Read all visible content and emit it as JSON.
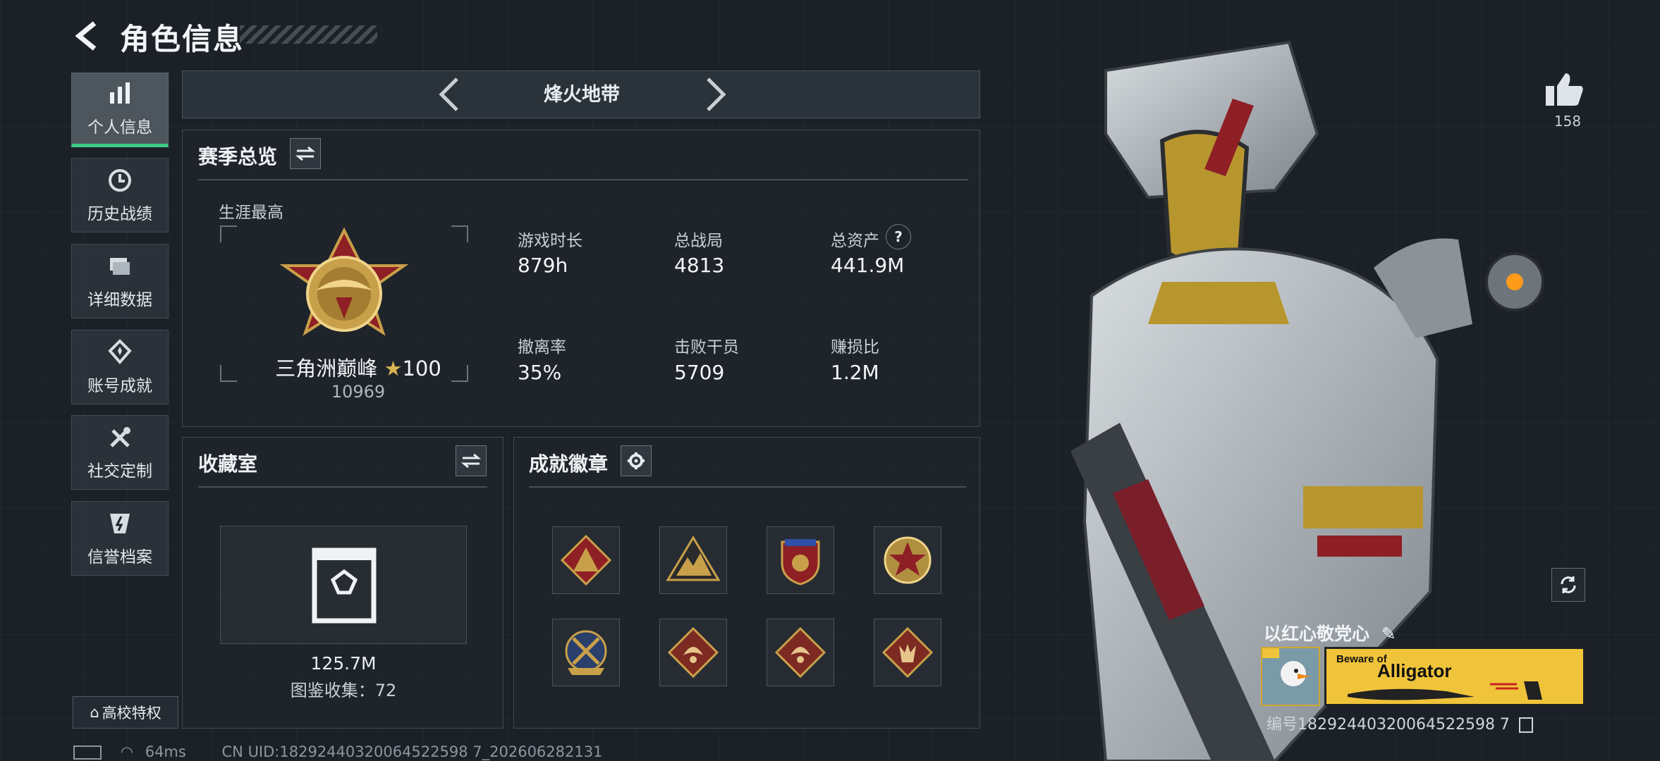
{
  "header": {
    "title": "角色信息"
  },
  "sidebar": {
    "items": [
      {
        "label": "个人信息",
        "icon": "bar-chart-icon",
        "active": true
      },
      {
        "label": "历史战绩",
        "icon": "history-clock-icon",
        "active": false
      },
      {
        "label": "详细数据",
        "icon": "folder-icon",
        "active": false
      },
      {
        "label": "账号成就",
        "icon": "medal-icon",
        "active": false
      },
      {
        "label": "社交定制",
        "icon": "tools-icon",
        "active": false
      },
      {
        "label": "信誉档案",
        "icon": "credit-shield-icon",
        "active": false
      }
    ],
    "campus_label": "高校特权"
  },
  "mode": {
    "name": "烽火地带"
  },
  "season": {
    "title": "赛季总览",
    "career_label": "生涯最高",
    "rank_name": "三角洲巅峰",
    "rank_stars": "100",
    "rank_score": "10969",
    "stats": [
      {
        "label": "游戏时长",
        "value": "879h"
      },
      {
        "label": "总战局",
        "value": "4813"
      },
      {
        "label": "总资产",
        "value": "441.9M"
      },
      {
        "label": "撤离率",
        "value": "35%"
      },
      {
        "label": "击败干员",
        "value": "5709"
      },
      {
        "label": "赚损比",
        "value": "1.2M"
      }
    ]
  },
  "collection": {
    "title": "收藏室",
    "value": "125.7M",
    "catalog": "图鉴收集：72"
  },
  "achievements": {
    "title": "成就徽章",
    "badges": [
      "triangle-badge-icon",
      "mountain-badge-icon",
      "shield-badge-icon",
      "star-badge-icon",
      "crossed-badge-icon",
      "dragon-badge-icon",
      "dragon-badge-icon",
      "beast-badge-icon"
    ]
  },
  "profile": {
    "likes": "158",
    "nickname": "以红心敬党心",
    "card_top": "Beware of",
    "card_main": "Alligator",
    "uid_right": "编号18292440320064522598 7",
    "uid_footer": "CN UID:18292440320064522598 7_202606282131",
    "ping": "64ms"
  },
  "colors": {
    "accent_green": "#3ec98a",
    "gold": "#c9a04a",
    "panel_bg": "#1e252c"
  }
}
